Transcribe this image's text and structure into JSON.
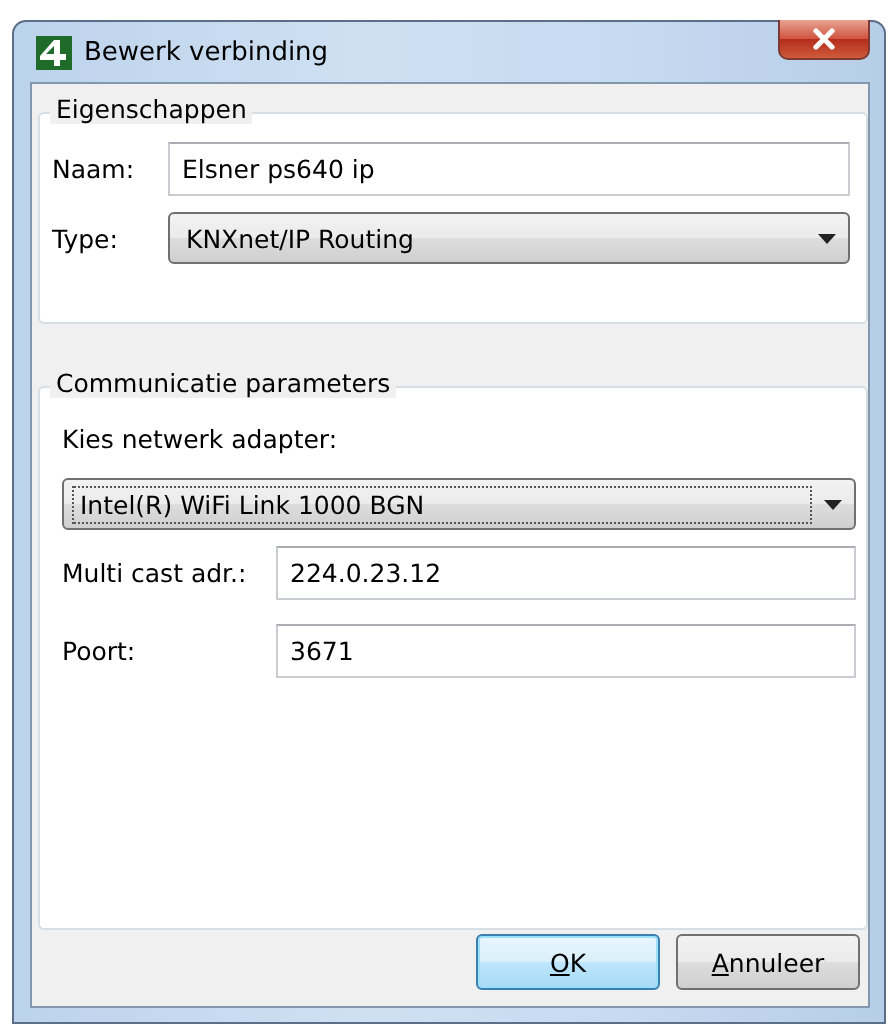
{
  "window": {
    "title": "Bewerk verbinding"
  },
  "properties_group": {
    "title": "Eigenschappen",
    "fields": [
      {
        "kind": "text",
        "label": "Naam:",
        "value": "Elsner ps640 ip"
      },
      {
        "kind": "dropdown",
        "label": "Type:",
        "value": "KNXnet/IP Routing",
        "focused": false
      }
    ]
  },
  "communication_group": {
    "title": "Communicatie parameters",
    "adapter_label": "Kies netwerk adapter:",
    "adapter": {
      "value": "Intel(R) WiFi Link 1000 BGN",
      "focused": true
    },
    "fields": [
      {
        "kind": "text",
        "label": "Multi cast adr.:",
        "value": "224.0.23.12"
      },
      {
        "kind": "text",
        "label": "Poort:",
        "value": "3671"
      }
    ]
  },
  "buttons": [
    {
      "label": "OK",
      "default": true,
      "underline_first": true
    },
    {
      "label": "Annuleer",
      "default": false,
      "underline_first": true
    }
  ]
}
